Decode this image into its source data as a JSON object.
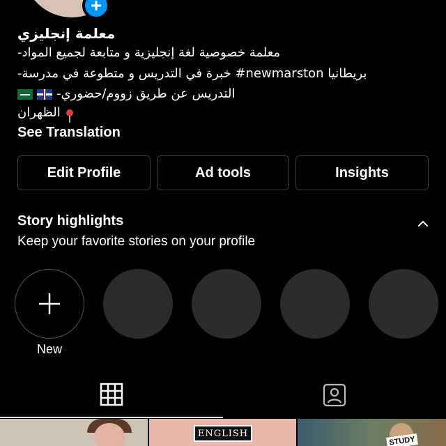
{
  "profile": {
    "name": "معلمة إنجليزي",
    "bio": [
      "-معلمة خصوصية لغة إنجليزية و متابعة لجميع المواد",
      "-خبرة في التدريس و متطوعة في مدرسة #newmarston بريطانيا",
      "-التدريس عن طريق زووم/حضوري",
      "الظهران"
    ],
    "see_translation": "See Translation"
  },
  "buttons": {
    "edit_profile": "Edit Profile",
    "ad_tools": "Ad tools",
    "insights": "Insights"
  },
  "story_highlights": {
    "title": "Story highlights",
    "subtitle": "Keep your favorite stories on your profile",
    "new_label": "New"
  },
  "posts": {
    "thumb2_label": "ENGLISH",
    "thumb3_label": "STUDY"
  },
  "icons": {
    "add_badge": "plus-icon",
    "collapse": "chevron-up-icon",
    "grid_tab": "grid-icon",
    "tagged_tab": "tagged-person-icon"
  },
  "colors": {
    "background": "#000000",
    "accent": "#0095f6",
    "border": "#3a3a3a",
    "highlight_placeholder": "#2b2b2b"
  }
}
